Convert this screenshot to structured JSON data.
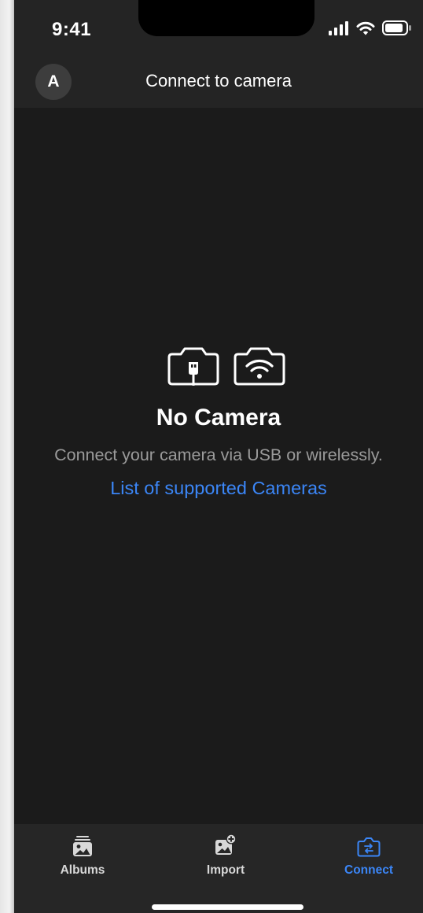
{
  "status_bar": {
    "time": "9:41",
    "icons": [
      "cellular-signal-icon",
      "wifi-icon",
      "battery-icon"
    ]
  },
  "nav_bar": {
    "avatar_initial": "A",
    "title": "Connect to camera"
  },
  "empty_state": {
    "icons": [
      "camera-usb-icon",
      "camera-wifi-icon"
    ],
    "title": "No Camera",
    "description": "Connect your camera via USB or wirelessly.",
    "link": "List of supported Cameras"
  },
  "tab_bar": {
    "tabs": [
      {
        "label": "Albums",
        "icon": "albums-icon",
        "active": false
      },
      {
        "label": "Import",
        "icon": "import-photo-icon",
        "active": false
      },
      {
        "label": "Connect",
        "icon": "connect-camera-icon",
        "active": true
      }
    ]
  },
  "colors": {
    "background": "#1b1b1b",
    "bar_background": "#242424",
    "accent": "#3b86f7",
    "secondary_text": "#9a9a9a"
  }
}
